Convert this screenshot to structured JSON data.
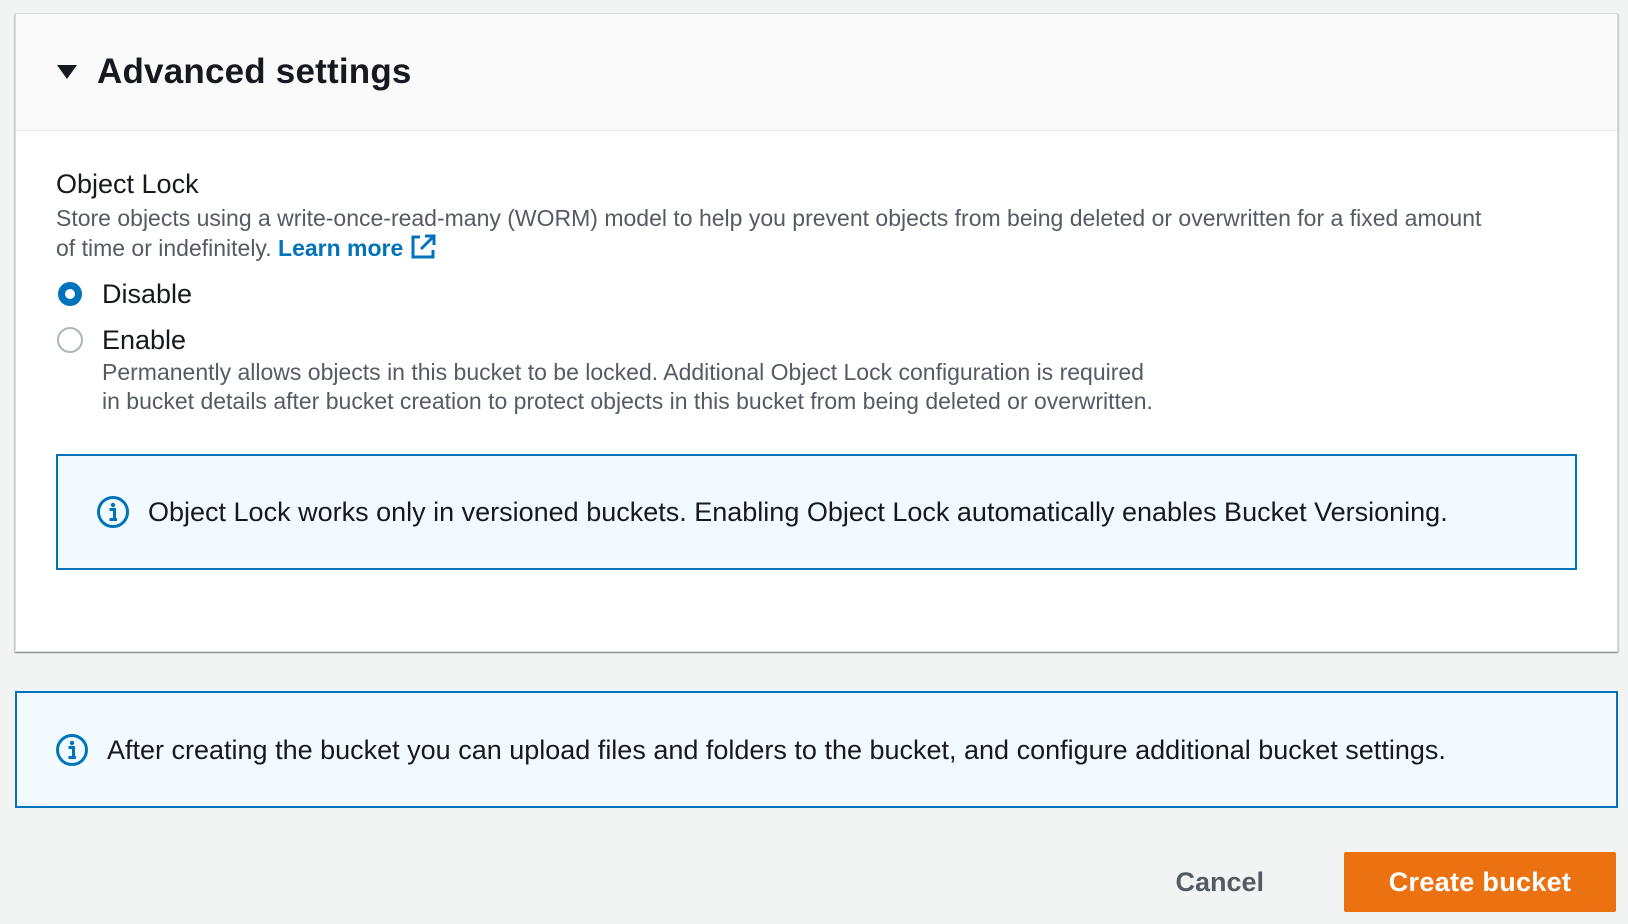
{
  "advanced_settings": {
    "title": "Advanced settings",
    "expanded": true
  },
  "object_lock": {
    "label": "Object Lock",
    "description": "Store objects using a write-once-read-many (WORM) model to help you prevent objects from being deleted or overwritten for a fixed amount of time or indefinitely. ",
    "learn_more": "Learn more",
    "options": [
      {
        "label": "Disable",
        "selected": true
      },
      {
        "label": "Enable",
        "selected": false,
        "description": "Permanently allows objects in this bucket to be locked. Additional Object Lock configuration is required in bucket details after bucket creation to protect objects in this bucket from being deleted or overwritten."
      }
    ],
    "info_alert": "Object Lock works only in versioned buckets. Enabling Object Lock automatically enables Bucket Versioning."
  },
  "bottom_info": "After creating the bucket you can upload files and folders to the bucket, and configure additional bucket settings.",
  "actions": {
    "cancel": "Cancel",
    "create": "Create bucket"
  },
  "colors": {
    "primary_button": "#ec7211",
    "link": "#0073bb",
    "info_border": "#0073bb",
    "info_background": "#f1faff",
    "page_background": "#f2f3f3"
  }
}
